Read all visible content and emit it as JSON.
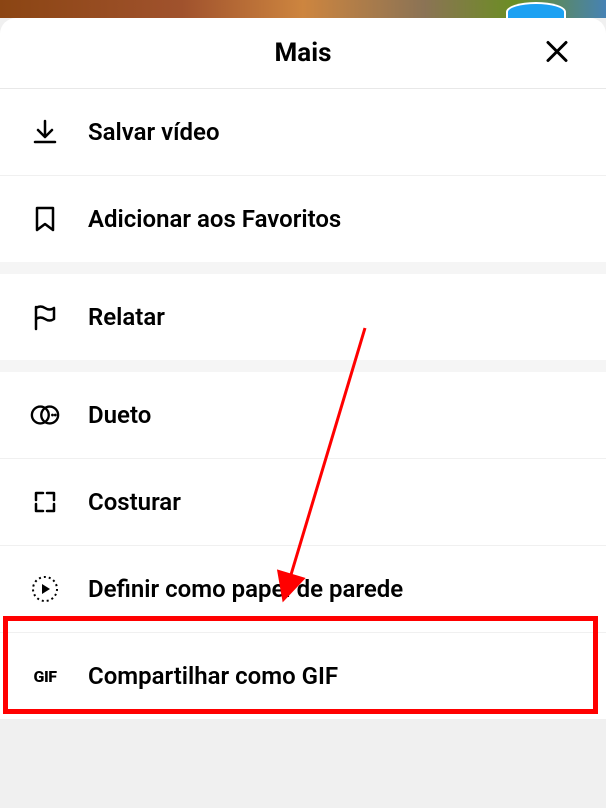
{
  "header": {
    "title": "Mais"
  },
  "menu": {
    "save_video": "Salvar vídeo",
    "add_favorites": "Adicionar aos Favoritos",
    "report": "Relatar",
    "duet": "Dueto",
    "stitch": "Costurar",
    "set_wallpaper": "Definir como papel de parede",
    "share_gif": "Compartilhar como GIF"
  },
  "icons": {
    "gif_text": "GIF"
  }
}
